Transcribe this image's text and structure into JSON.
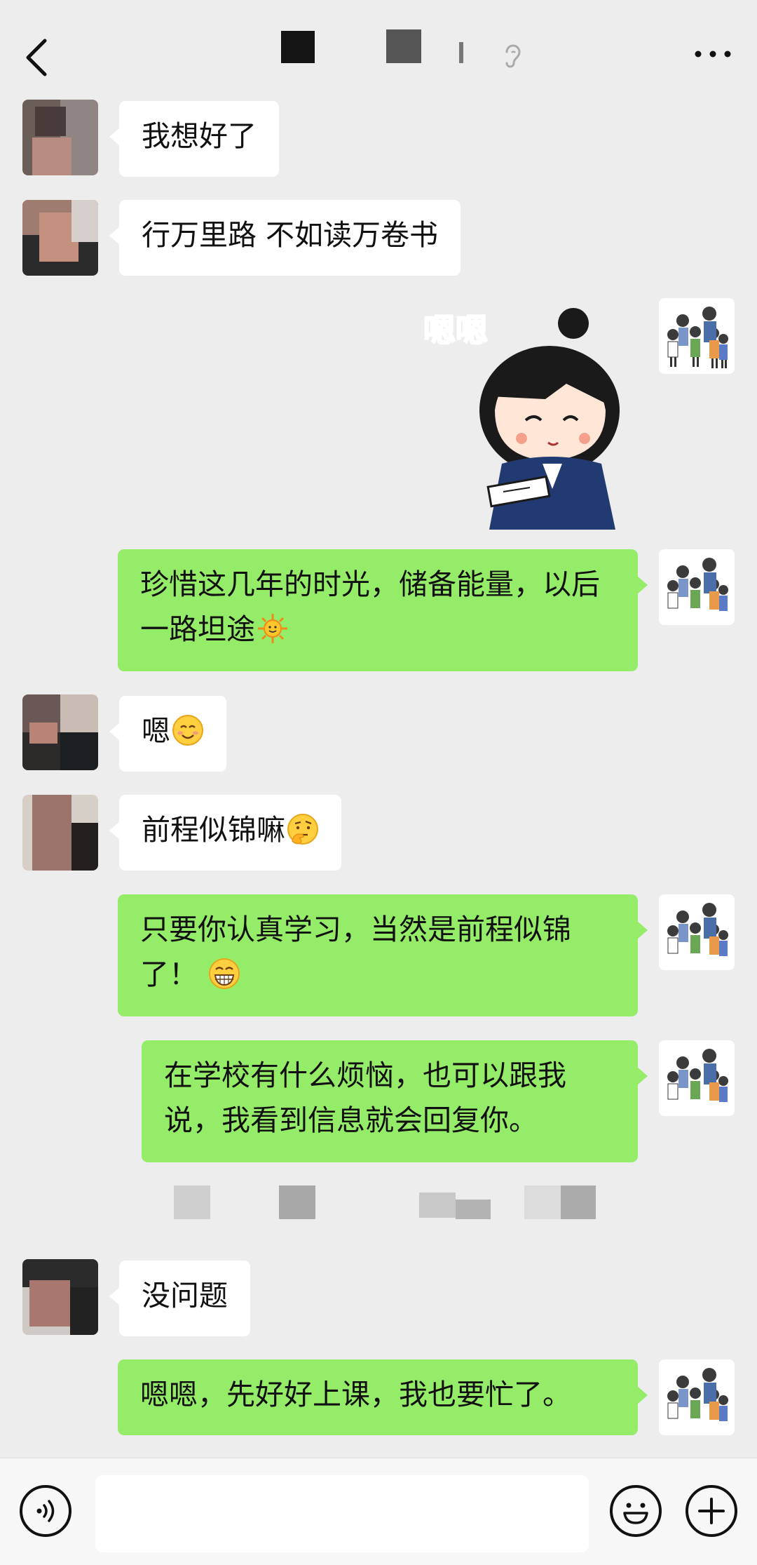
{
  "header": {
    "back_icon": "chevron-left-icon",
    "more_icon": "more-dots-icon",
    "ear_icon": "earpiece-mode-icon"
  },
  "messages": [
    {
      "side": "left",
      "text": "我想好了"
    },
    {
      "side": "left",
      "text": "行万里路  不如读万卷书"
    },
    {
      "side": "right",
      "type": "sticker",
      "sticker_text": "嗯嗯"
    },
    {
      "side": "right",
      "text": "珍惜这几年的时光，储备能量，以后一路坦途",
      "emoji": "sun-emoji"
    },
    {
      "side": "left",
      "text": "嗯",
      "emoji": "smiling-face-emoji"
    },
    {
      "side": "left",
      "text": "前程似锦嘛",
      "emoji": "thinking-face-emoji"
    },
    {
      "side": "right",
      "text": "只要你认真学习，当然是前程似锦了！",
      "emoji": "grinning-face-emoji"
    },
    {
      "side": "right",
      "text": "在学校有什么烦恼，也可以跟我说，我看到信息就会回复你。"
    },
    {
      "side": "left",
      "text": "没问题"
    },
    {
      "side": "right",
      "text": "嗯嗯，先好好上课，我也要忙了。"
    }
  ],
  "bottom_bar": {
    "voice_icon": "voice-input-icon",
    "input_value": "",
    "emoji_icon": "emoji-icon",
    "plus_icon": "plus-icon"
  },
  "colors": {
    "background": "#ededed",
    "sent_bubble": "#95ec69",
    "received_bubble": "#ffffff"
  }
}
